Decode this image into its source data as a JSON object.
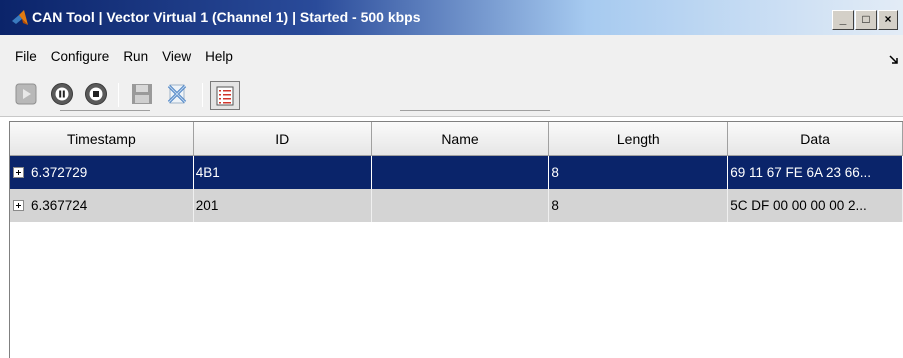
{
  "window": {
    "title": "CAN Tool  |  Vector Virtual 1 (Channel 1)  |  Started - 500 kbps",
    "minimize_label": "_",
    "maximize_label": "□",
    "close_label": "×"
  },
  "menu": {
    "items": [
      "File",
      "Configure",
      "Run",
      "View",
      "Help"
    ]
  },
  "toolbar": {
    "buttons": [
      "start-icon",
      "pause-icon",
      "stop-icon",
      "save-icon",
      "clear-icon",
      "message-list-icon"
    ]
  },
  "table": {
    "columns": [
      "Timestamp",
      "ID",
      "Name",
      "Length",
      "Data"
    ],
    "rows": [
      {
        "expand": "+",
        "timestamp": "6.372729",
        "id": "4B1",
        "name": "",
        "length": "8",
        "data": "69 11 67 FE 6A 23 66...",
        "selected": true
      },
      {
        "expand": "+",
        "timestamp": "6.367724",
        "id": "201",
        "name": "",
        "length": "8",
        "data": "5C DF 00 00 00 00 2...",
        "selected": false
      }
    ]
  },
  "colors": {
    "selection": "#0a246a",
    "row_background": "#d4d4d4",
    "title_gradient_start": "#0b246a"
  }
}
